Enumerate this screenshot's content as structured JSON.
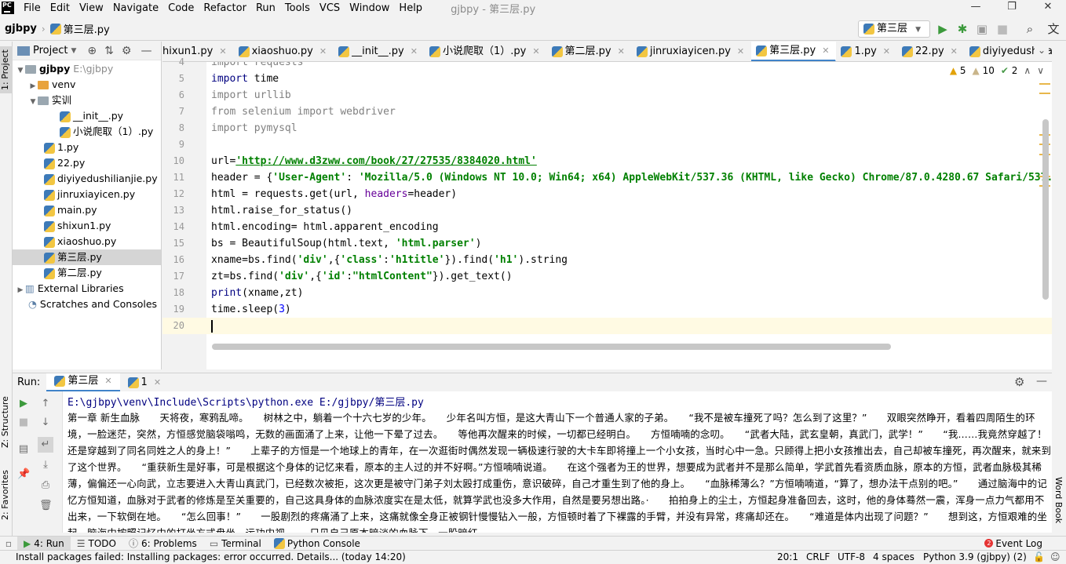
{
  "menubar": {
    "logo": "PC",
    "items": [
      "File",
      "Edit",
      "View",
      "Navigate",
      "Code",
      "Refactor",
      "Run",
      "Tools",
      "VCS",
      "Window",
      "Help"
    ],
    "window_title": "gjbpy - 第三层.py",
    "minimize": "—",
    "maximize": "❐",
    "close": "✕"
  },
  "navbar": {
    "project": "gjbpy",
    "file": "第三层.py",
    "run_config": "第三层"
  },
  "project_panel": {
    "title": "Project",
    "tree": [
      {
        "label": "gjbpy",
        "hint": "E:\\gjbpy"
      },
      {
        "label": "venv"
      },
      {
        "label": "实训"
      },
      {
        "label": "__init__.py"
      },
      {
        "label": "小说爬取（1）.py"
      },
      {
        "label": "1.py"
      },
      {
        "label": "22.py"
      },
      {
        "label": "diyiyedushilianjie.py"
      },
      {
        "label": "jinruxiayicen.py"
      },
      {
        "label": "main.py"
      },
      {
        "label": "shixun1.py"
      },
      {
        "label": "xiaoshuo.py"
      },
      {
        "label": "第三层.py"
      },
      {
        "label": "第二层.py"
      },
      {
        "label": "External Libraries"
      },
      {
        "label": "Scratches and Consoles"
      }
    ]
  },
  "tabs": [
    "hixun1.py",
    "xiaoshuo.py",
    "__init__.py",
    "小说爬取（1）.py",
    "第二层.py",
    "jinruxiayicen.py",
    "第三层.py",
    "1.py",
    "22.py",
    "diyiyedushilianjie.py"
  ],
  "inspections": {
    "warnings": "5",
    "weak": "10",
    "ok": "2"
  },
  "editor": {
    "line_numbers": [
      "4",
      "5",
      "6",
      "7",
      "8",
      "9",
      "10",
      "11",
      "12",
      "13",
      "14",
      "15",
      "16",
      "17",
      "18",
      "19",
      "20"
    ],
    "l4": "import requests",
    "l5a": "import",
    "l5b": " time",
    "l6": "import urllib",
    "l7": "from selenium import webdriver",
    "l8": "import pymysql",
    "l10a": "url=",
    "l10b": "'http://www.d3zww.com/book/27/27535/8384020.html'",
    "l11a": "header = {",
    "l11b": "'User-Agent'",
    "l11c": ": ",
    "l11d": "'Mozilla/5.0 (Windows NT 10.0; Win64; x64) AppleWebKit/537.36 (KHTML, like Gecko) Chrome/87.0.4280.67 Safari/537.36'",
    "l12a": "html = requests.get(url, ",
    "l12b": "headers",
    "l12c": "=header)",
    "l13": "html.raise_for_status()",
    "l14": "html.encoding= html.apparent_encoding",
    "l15a": "bs = BeautifulSoup(html.text, ",
    "l15b": "'html.parser'",
    "l15c": ")",
    "l16a": "xname=bs.find(",
    "l16b": "'div'",
    "l16c": ",{",
    "l16d": "'class'",
    "l16e": ":",
    "l16f": "'h1title'",
    "l16g": "}).find(",
    "l16h": "'h1'",
    "l16i": ").string",
    "l17a": "zt=bs.find(",
    "l17b": "'div'",
    "l17c": ",{",
    "l17d": "'id'",
    "l17e": ":",
    "l17f": "\"htmlContent\"",
    "l17g": "}).get_text()",
    "l18a": "print",
    "l18b": "(xname,zt)",
    "l19a": "time.sleep(",
    "l19b": "3",
    "l19c": ")"
  },
  "run": {
    "label": "Run:",
    "tabs": [
      "第三层",
      "1"
    ],
    "command": "E:\\gjbpy\\venv\\Include\\Scripts\\python.exe E:/gjbpy/第三层.py",
    "output": "第一章 新生血脉　　天将夜，寒鸦乱啼。　　树林之中，躺着一个十六七岁的少年。　　少年名叫方恒，是这大青山下一个普通人家的子弟。　　“我不是被车撞死了吗？怎么到了这里？”　　双眼突然睁开，看着四周陌生的环境，一脸迷茫，突然，方恒感觉脑袋嗡鸣，无数的画面涌了上来，让他一下晕了过去。　　等他再次醒来的时候，一切都已经明白。　　方恒喃喃的念叨。　　“武者大陆，武玄皇朝，真武门，武学！”　　“我……我竟然穿越了！还是穿越到了同名同姓之人的身上！”　　上辈子的方恒是一个地球上的青年，在一次逛街时偶然发现一辆极速行驶的大卡车即将撞上一个小女孩，当时心中一急。只顾得上把小女孩推出去，自己却被车撞死，再次醒来，就来到了这个世界。　　“重获新生是好事，可是根据这个身体的记忆来看，原本的主人过的并不好啊。”方恒喃喃说道。　　在这个强者为王的世界，想要成为武者并不是那么简单，学武首先看资质血脉，原本的方恒，武者血脉极其稀薄，偏偏还一心向武，立志要进入大青山真武门，已经数次被拒，这次更是被守门弟子刘太殴打成重伤，意识破碎，自己才重生到了他的身上。　　“血脉稀薄么？”方恒喃喃道，“算了，想办法干点别的吧。”　　通过脑海中的记忆方恒知道，血脉对于武者的修炼是至关重要的，自己这具身体的血脉浓度实在是太低，就算学武也没多大作用，自然是要另想出路。·　　拍拍身上的尘土，方恒起身准备回去，这时，他的身体蓦然一震，浑身一点力气都用不出来，一下软倒在地。　　“怎么回事！”　　一股剧烈的疼痛涌了上来，这痛就像全身正被钢针慢慢钻入一般，方恒顿时着了下裸露的手臂，并没有异常，疼痛却还在。　　“难道是体内出现了问题？”　　想到这，方恒艰难的坐起，脑海中按照记忆中的打坐方式盘坐，运功内视。　　只见自己原本暗淡的血脉下，一股暗红"
  },
  "side_tabs": {
    "project": "1: Project",
    "structure": "Z: Structure",
    "favorites": "2: Favorites",
    "wordbook": "Word Book"
  },
  "toolwindows": [
    "4: Run",
    "TODO",
    "6: Problems",
    "Terminal",
    "Python Console"
  ],
  "event_log": "Event Log",
  "status": {
    "message": "Install packages failed: Installing packages: error occurred. Details... (today 14:20)",
    "position": "20:1",
    "line_sep": "CRLF",
    "encoding": "UTF-8",
    "indent": "4 spaces",
    "interpreter": "Python 3.9 (gjbpy) (2)"
  }
}
